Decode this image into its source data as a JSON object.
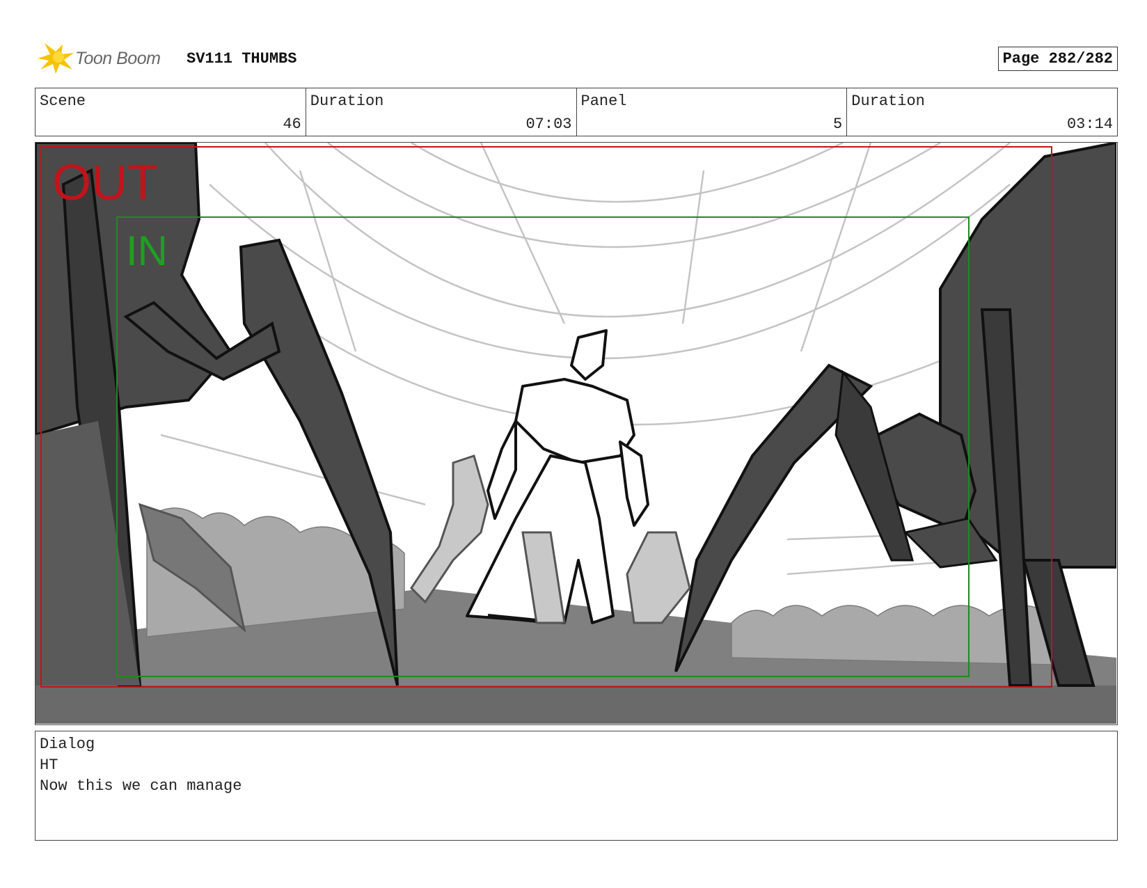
{
  "header": {
    "logo_text": "Toon Boom",
    "project_title": "SV111 THUMBS",
    "page_label": "Page 282/282"
  },
  "info": [
    {
      "label": "Scene",
      "value": "46"
    },
    {
      "label": "Duration",
      "value": "07:03"
    },
    {
      "label": "Panel",
      "value": "5"
    },
    {
      "label": "Duration",
      "value": "03:14"
    }
  ],
  "frame": {
    "out_label": "OUT",
    "in_label": "IN",
    "colors": {
      "out": "#c0141c",
      "in": "#1e8a1e",
      "ink": "#111111",
      "shadow": "#4a4a4a"
    }
  },
  "dialog": {
    "label": "Dialog",
    "speaker": "HT",
    "line": "Now this we can manage"
  }
}
